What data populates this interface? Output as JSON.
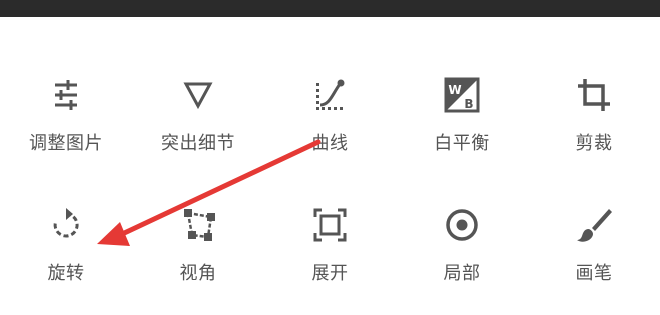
{
  "tools_row1": [
    {
      "label": "调整图片",
      "icon": "tune-sliders-icon"
    },
    {
      "label": "突出细节",
      "icon": "triangle-down-icon"
    },
    {
      "label": "曲线",
      "icon": "curves-icon"
    },
    {
      "label": "白平衡",
      "icon": "white-balance-wb-icon"
    },
    {
      "label": "剪裁",
      "icon": "crop-icon"
    }
  ],
  "tools_row2": [
    {
      "label": "旋转",
      "icon": "rotate-icon"
    },
    {
      "label": "视角",
      "icon": "perspective-icon"
    },
    {
      "label": "展开",
      "icon": "expand-icon"
    },
    {
      "label": "局部",
      "icon": "selective-target-icon"
    },
    {
      "label": "画笔",
      "icon": "brush-icon"
    }
  ],
  "wb_icon_text": {
    "w": "W",
    "b": "B"
  },
  "colors": {
    "icon": "#555555",
    "label": "#555555",
    "annotation_arrow": "#e53935",
    "top_bar": "#2b2b2b"
  }
}
